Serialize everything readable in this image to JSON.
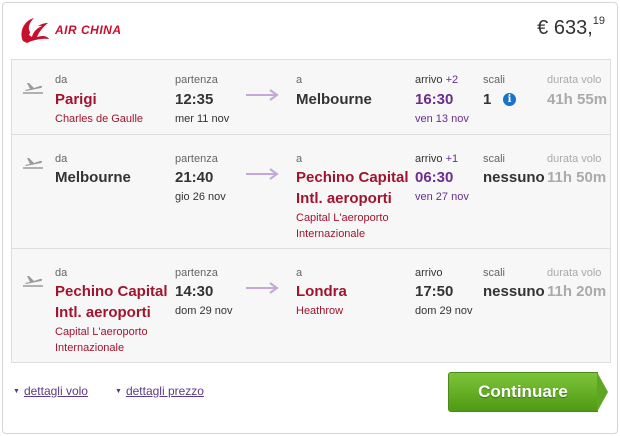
{
  "airline": {
    "name": "AIR CHINA",
    "brand_color": "#c8102e"
  },
  "price": {
    "main": "€ 633,",
    "cents": "19"
  },
  "labels": {
    "from": "da",
    "departure": "partenza",
    "to": "a",
    "arrival": "arrivo",
    "stops": "scali",
    "duration": "durata volo"
  },
  "segments": [
    {
      "from_city": "Parigi",
      "from_airport": "Charles de Gaulle",
      "dep_time": "12:35",
      "dep_date": "mer 11 nov",
      "to_city": "Melbourne",
      "to_airport": "",
      "arr_day_offset": "+2",
      "arr_time": "16:30",
      "arr_date": "ven 13 nov",
      "stops": "1",
      "duration": "41h 55m"
    },
    {
      "from_city": "Melbourne",
      "from_airport": "",
      "dep_time": "21:40",
      "dep_date": "gio 26 nov",
      "to_city_line1": "Pechino Capital",
      "to_city_line2": "Intl. aeroporti",
      "to_airport_line1": "Capital L'aeroporto",
      "to_airport_line2": "Internazionale",
      "arr_day_offset": "+1",
      "arr_time": "06:30",
      "arr_date": "ven 27 nov",
      "stops": "nessuno",
      "duration": "11h 50m"
    },
    {
      "from_city_line1": "Pechino Capital",
      "from_city_line2": "Intl. aeroporti",
      "from_airport_line1": "Capital L'aeroporto",
      "from_airport_line2": "Internazionale",
      "dep_time": "14:30",
      "dep_date": "dom 29 nov",
      "to_city": "Londra",
      "to_airport": "Heathrow",
      "arr_time": "17:50",
      "arr_date": "dom 29 nov",
      "stops": "nessuno",
      "duration": "11h 20m"
    }
  ],
  "footer": {
    "flight_details": "dettagli volo",
    "price_details": "dettagli prezzo",
    "continue": "Continuare"
  },
  "colors": {
    "city_red": "#a0142e",
    "arrival_purple": "#6a2c91",
    "button_green": "#5ea622",
    "info_blue": "#1a73c9"
  },
  "icons": [
    "air-china-logo-icon",
    "plane-takeoff-icon",
    "arrow-right-icon",
    "info-icon",
    "caret-down-icon"
  ]
}
